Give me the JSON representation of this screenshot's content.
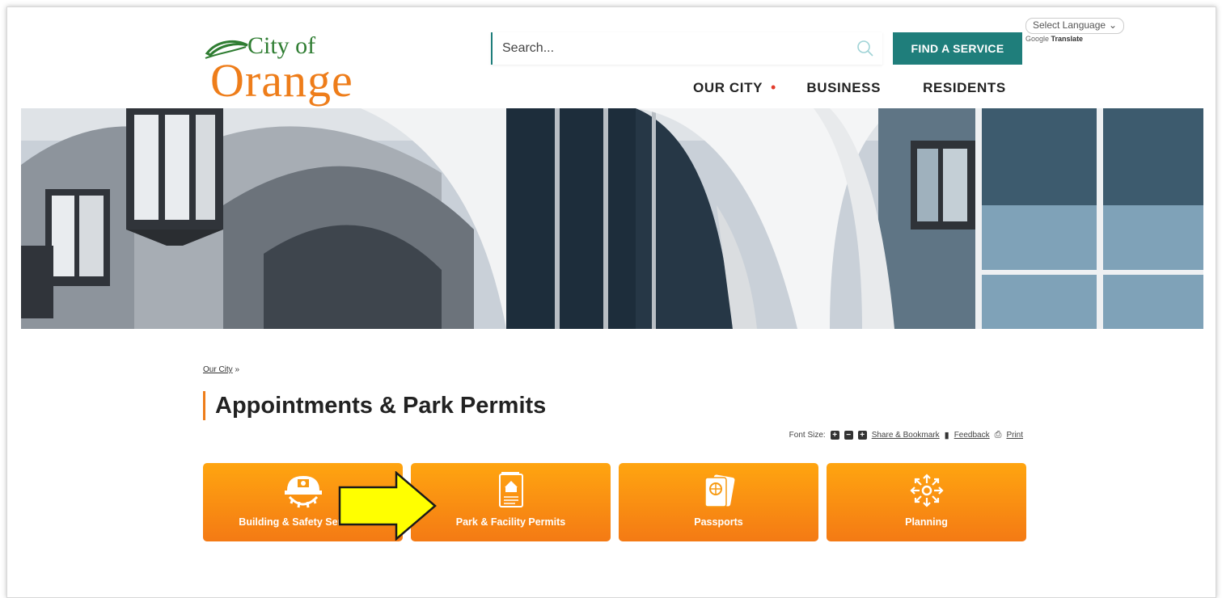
{
  "header": {
    "logo_top": "City of",
    "logo_bottom": "Orange",
    "search_placeholder": "Search...",
    "find_button": "FIND A SERVICE",
    "language_select": "Select Language",
    "translate_brand": "Google",
    "translate_label": "Translate",
    "nav": [
      "OUR CITY",
      "BUSINESS",
      "RESIDENTS"
    ]
  },
  "breadcrumb": {
    "link": "Our City",
    "sep": " »"
  },
  "page_title": "Appointments & Park Permits",
  "tools": {
    "font_size_label": "Font Size:",
    "share_label": "Share & Bookmark",
    "feedback_label": "Feedback",
    "print_label": "Print"
  },
  "tiles": [
    {
      "label": "Building & Safety Services",
      "icon": "hardhat-gear-icon"
    },
    {
      "label": "Park & Facility Permits",
      "icon": "permit-document-icon"
    },
    {
      "label": "Passports",
      "icon": "passport-icon"
    },
    {
      "label": "Planning",
      "icon": "planning-arrows-icon"
    }
  ],
  "colors": {
    "brand_orange": "#ee7d1a",
    "brand_green": "#2f7d32",
    "teal": "#1f7e7b",
    "tile_top": "#ffa510",
    "tile_bottom": "#f47a14",
    "annotation_arrow": "#ffff00"
  }
}
